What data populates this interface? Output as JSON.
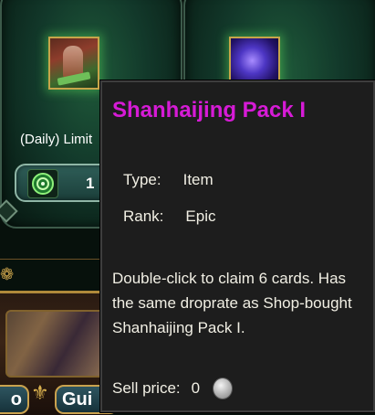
{
  "shop": {
    "items": [
      {
        "title": "(Daily) Limit",
        "count": "1"
      },
      {
        "title": ""
      }
    ]
  },
  "bottom": {
    "buttons": [
      {
        "label": "o"
      },
      {
        "label": "Gui"
      }
    ]
  },
  "tooltip": {
    "title": "Shanhaijing Pack I",
    "type_label": "Type:",
    "type_value": "Item",
    "rank_label": "Rank:",
    "rank_value": "Epic",
    "description": "Double-click to claim 6 cards. Has the same droprate as Shop-bought Shanhaijing Pack I.",
    "price_label": "Sell price:",
    "price_value": "0",
    "title_color": "#d61bd6",
    "currency_icon": "silver-coin-icon"
  }
}
